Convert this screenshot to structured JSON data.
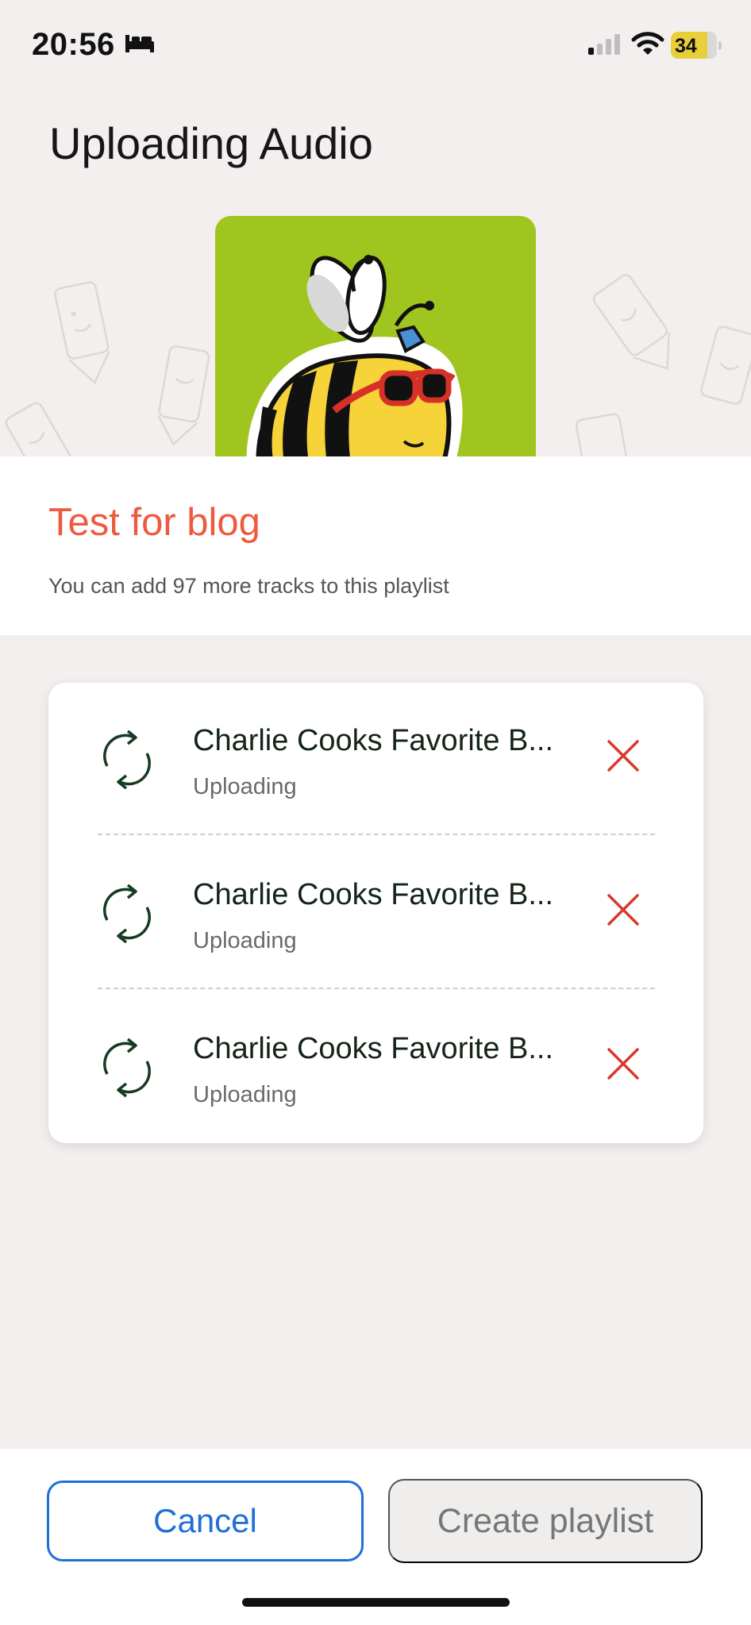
{
  "status_bar": {
    "time": "20:56",
    "battery_level": "34",
    "icons": [
      "bed-icon",
      "cellular-signal-icon",
      "wifi-icon",
      "battery-charging-icon"
    ]
  },
  "header": {
    "title": "Uploading Audio",
    "artwork": "bee-with-sunglasses-illustration"
  },
  "playlist": {
    "name": "Test for blog",
    "tracks_remaining_text": "You can add 97 more tracks to this playlist"
  },
  "uploads": [
    {
      "title": "Charlie Cooks Favorite B...",
      "status": "Uploading"
    },
    {
      "title": "Charlie Cooks Favorite B...",
      "status": "Uploading"
    },
    {
      "title": "Charlie Cooks Favorite B...",
      "status": "Uploading"
    }
  ],
  "actions": {
    "cancel_label": "Cancel",
    "create_label": "Create playlist"
  },
  "colors": {
    "accent_red": "#ee5a3f",
    "button_blue": "#1f6fd8",
    "artwork_green": "#9fc51e",
    "sync_icon": "#163a22",
    "remove_icon": "#d83a2b"
  }
}
